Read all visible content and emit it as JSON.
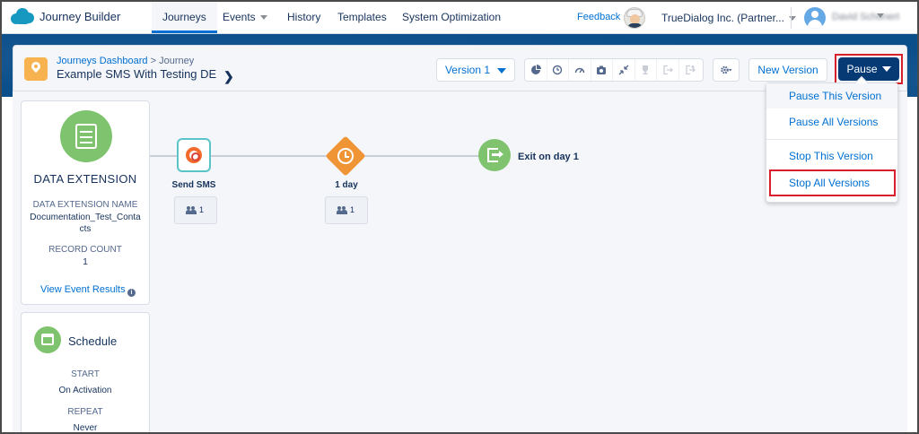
{
  "nav": {
    "app_name": "Journey Builder",
    "tabs": [
      {
        "label": "Journeys",
        "active": true
      },
      {
        "label": "Events",
        "active": false
      },
      {
        "label": "History",
        "active": false
      },
      {
        "label": "Templates",
        "active": false
      },
      {
        "label": "System Optimization",
        "active": false
      }
    ],
    "feedback": "Feedback",
    "org": "TrueDialog Inc. (Partner...",
    "user_name": "David Schonert"
  },
  "header": {
    "breadcrumb_link": "Journeys Dashboard",
    "breadcrumb_sep": ">",
    "breadcrumb_current": "Journey",
    "title": "Example SMS With Testing DE",
    "version_label": "Version 1",
    "new_version_label": "New Version",
    "pause_label": "Pause"
  },
  "toolbar_icons": [
    "pie-chart-icon",
    "history-icon",
    "gauge-icon",
    "camera-icon",
    "collapse-icon",
    "trophy-icon",
    "exit-icon",
    "exit-criteria-icon"
  ],
  "data_extension": {
    "title": "DATA EXTENSION",
    "name_label": "DATA EXTENSION NAME",
    "name_value_line1": "Documentation_Test_Conta",
    "name_value_line2": "cts",
    "record_count_label": "RECORD COUNT",
    "record_count_value": "1",
    "view_results": "View Event Results"
  },
  "schedule": {
    "title": "Schedule",
    "start_label": "START",
    "start_value": "On Activation",
    "repeat_label": "REPEAT",
    "repeat_value": "Never"
  },
  "canvas": {
    "sms_label": "Send SMS",
    "sms_count": "1",
    "wait_label": "1 day",
    "wait_count": "1",
    "exit_label": "Exit on day 1"
  },
  "pause_menu": {
    "items": [
      "Pause This Version",
      "Pause All Versions",
      "Stop This Version",
      "Stop All Versions"
    ]
  },
  "colors": {
    "accent": "#0070d2",
    "pause_button": "#063a75",
    "highlight": "#d6202b",
    "green": "#7fc36f",
    "orange": "#f09536"
  }
}
